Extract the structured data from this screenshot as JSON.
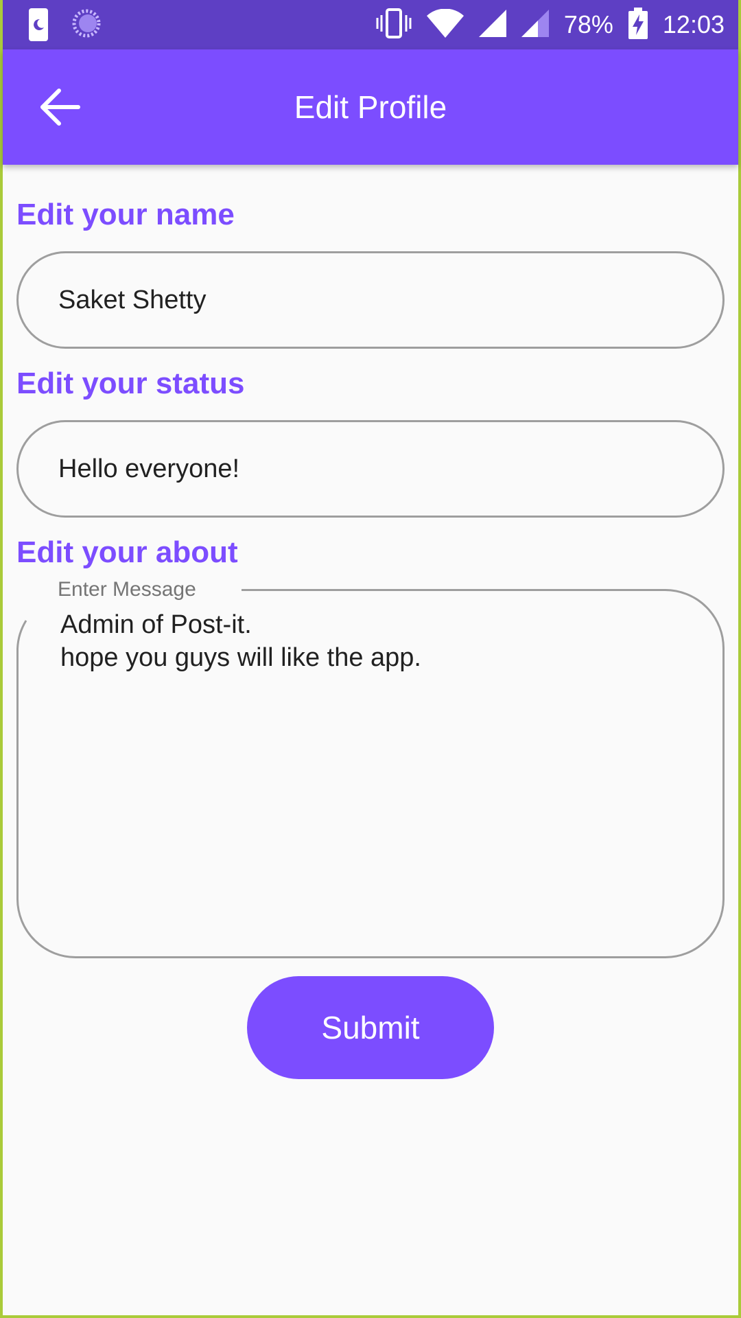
{
  "status_bar": {
    "battery": "78%",
    "time": "12:03",
    "icons": [
      "moon-icon",
      "sync-icon",
      "vibrate-icon",
      "wifi-icon",
      "signal-icon",
      "signal-weak-icon",
      "battery-charging-icon"
    ]
  },
  "app_bar": {
    "title": "Edit Profile",
    "back_icon": "arrow-left-icon"
  },
  "form": {
    "name_label": "Edit your name",
    "name_value": "Saket Shetty",
    "status_label": "Edit your status",
    "status_value": "Hello everyone!",
    "about_label": "Edit your about",
    "about_legend": "Enter Message",
    "about_line1": "Admin of Post-it.",
    "about_line2": "hope you guys will like the app.",
    "submit_label": "Submit"
  },
  "colors": {
    "accent": "#7c4dff",
    "status_bar": "#5e3fc4",
    "border": "#9e9e9e",
    "background": "#fafafa"
  }
}
